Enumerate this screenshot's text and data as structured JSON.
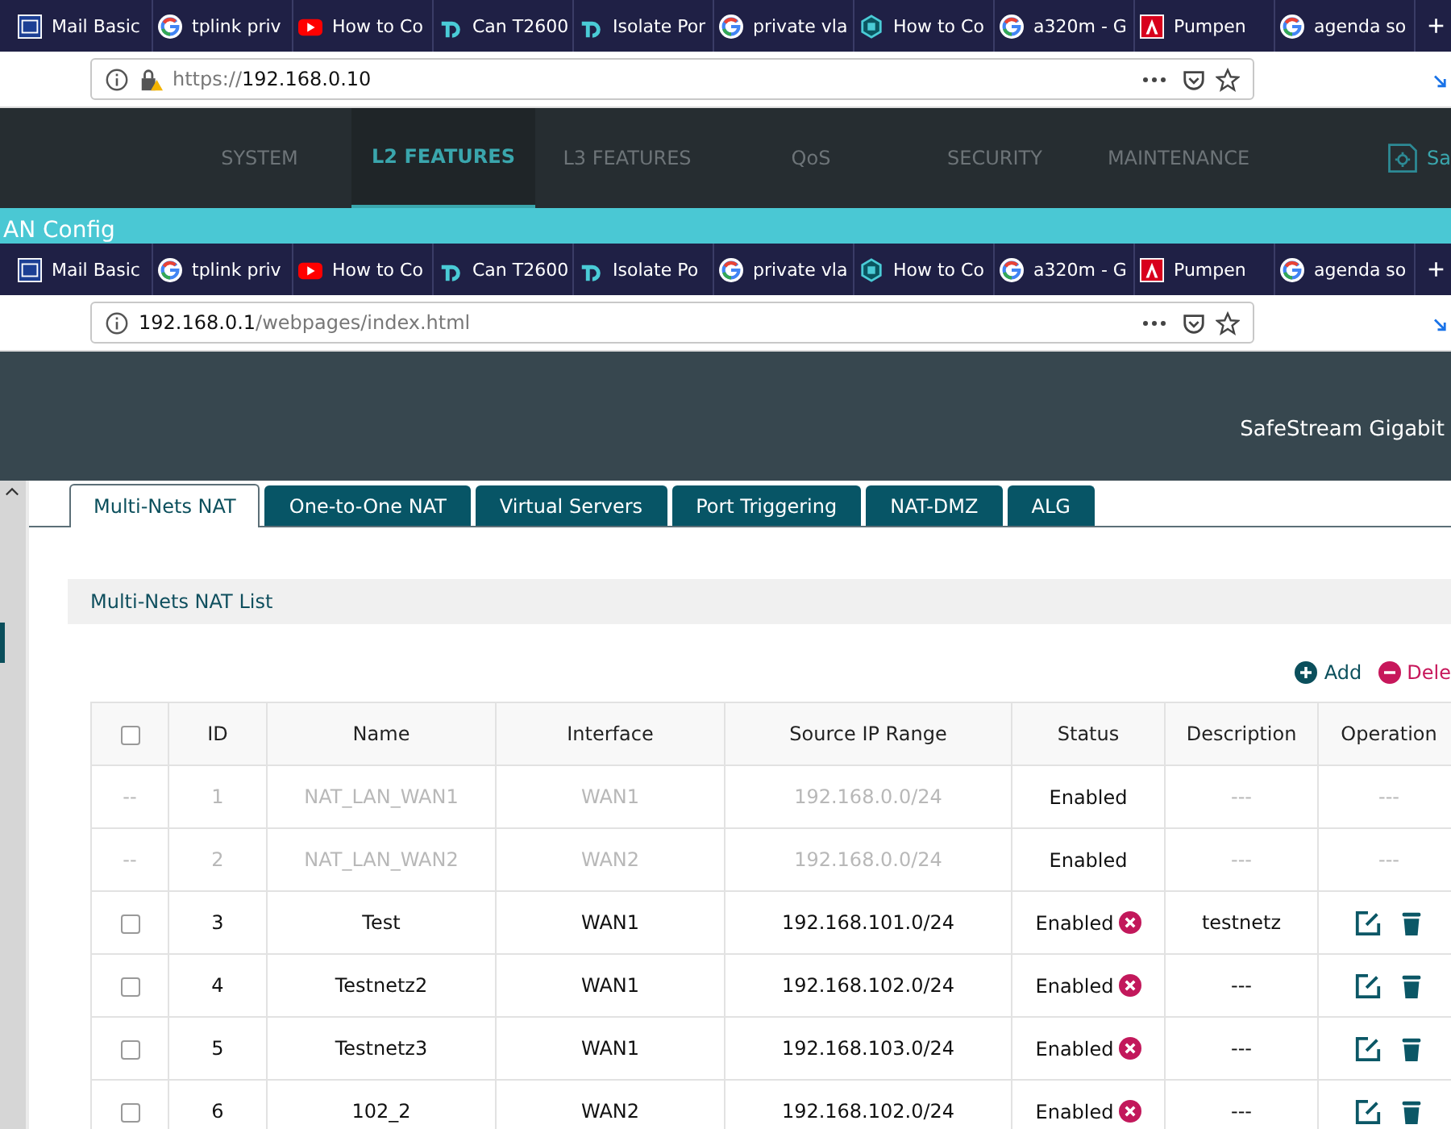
{
  "back_window": {
    "browser_tabs": [
      {
        "kind": "mail",
        "title": "Mail Basic"
      },
      {
        "kind": "google",
        "title": "tplink priv"
      },
      {
        "kind": "youtube",
        "title": "How to Co"
      },
      {
        "kind": "tplink",
        "title": "Can T2600"
      },
      {
        "kind": "tplink",
        "title": "Isolate Por"
      },
      {
        "kind": "google",
        "title": "private vla"
      },
      {
        "kind": "shield",
        "title": "How to Co"
      },
      {
        "kind": "google",
        "title": "a320m - G"
      },
      {
        "kind": "pdf",
        "title": "Pumpen"
      },
      {
        "kind": "google",
        "title": "agenda so"
      }
    ],
    "new_tab": "+",
    "url_parts": [
      {
        "text": "https://",
        "dim": true
      },
      {
        "text": "192.168.0.10",
        "dim": false
      }
    ],
    "insecure_lock": true,
    "nav": [
      {
        "label": "SYSTEM",
        "selected": false
      },
      {
        "label": "L2 FEATURES",
        "selected": true
      },
      {
        "label": "L3 FEATURES",
        "selected": false
      },
      {
        "label": "QoS",
        "selected": false
      },
      {
        "label": "SECURITY",
        "selected": false
      },
      {
        "label": "MAINTENANCE",
        "selected": false
      }
    ],
    "save_label": "Sa",
    "banner_title": "AN Config"
  },
  "front_window": {
    "browser_tabs": [
      {
        "kind": "mail",
        "title": "Mail Basic"
      },
      {
        "kind": "google",
        "title": "tplink priv"
      },
      {
        "kind": "youtube",
        "title": "How to Co"
      },
      {
        "kind": "tplink",
        "title": "Can T2600"
      },
      {
        "kind": "tplink",
        "title": "Isolate Po"
      },
      {
        "kind": "google",
        "title": "private vla"
      },
      {
        "kind": "shield",
        "title": "How to Co"
      },
      {
        "kind": "google",
        "title": "a320m - G"
      },
      {
        "kind": "pdf",
        "title": "Pumpen"
      },
      {
        "kind": "google",
        "title": "agenda so"
      }
    ],
    "new_tab": "+",
    "url_parts": [
      {
        "text": "192.168.0.1",
        "dim": false
      },
      {
        "text": "/webpages/index.html",
        "dim": true
      }
    ],
    "insecure_lock": false,
    "header_title": "SafeStream Gigabit",
    "tabs": [
      {
        "label": "Multi-Nets NAT",
        "selected": true
      },
      {
        "label": "One-to-One NAT",
        "selected": false
      },
      {
        "label": "Virtual Servers",
        "selected": false
      },
      {
        "label": "Port Triggering",
        "selected": false
      },
      {
        "label": "NAT-DMZ",
        "selected": false
      },
      {
        "label": "ALG",
        "selected": false
      }
    ],
    "section_title": "Multi-Nets NAT List",
    "actions": [
      {
        "kind": "add",
        "label": "Add"
      },
      {
        "kind": "delete",
        "label": "Dele"
      }
    ],
    "table": {
      "header_checked": false,
      "columns": [
        "ID",
        "Name",
        "Interface",
        "Source IP Range",
        "Status",
        "Description",
        "Operation"
      ],
      "rows": [
        {
          "kind": "system",
          "check_text": "--",
          "id": "1",
          "name": "NAT_LAN_WAN1",
          "interface": "WAN1",
          "range": "192.168.0.0/24",
          "status": "Enabled",
          "description": "---",
          "operation": "---"
        },
        {
          "kind": "system",
          "check_text": "--",
          "id": "2",
          "name": "NAT_LAN_WAN2",
          "interface": "WAN2",
          "range": "192.168.0.0/24",
          "status": "Enabled",
          "description": "---",
          "operation": "---"
        },
        {
          "kind": "user",
          "checked": false,
          "id": "3",
          "name": "Test",
          "interface": "WAN1",
          "range": "192.168.101.0/24",
          "status": "Enabled",
          "description": "testnetz"
        },
        {
          "kind": "user",
          "checked": false,
          "id": "4",
          "name": "Testnetz2",
          "interface": "WAN1",
          "range": "192.168.102.0/24",
          "status": "Enabled",
          "description": "---"
        },
        {
          "kind": "user",
          "checked": false,
          "id": "5",
          "name": "Testnetz3",
          "interface": "WAN1",
          "range": "192.168.103.0/24",
          "status": "Enabled",
          "description": "---"
        },
        {
          "kind": "user",
          "checked": false,
          "id": "6",
          "name": "102_2",
          "interface": "WAN2",
          "range": "192.168.102.0/24",
          "status": "Enabled",
          "description": "---"
        }
      ]
    }
  }
}
